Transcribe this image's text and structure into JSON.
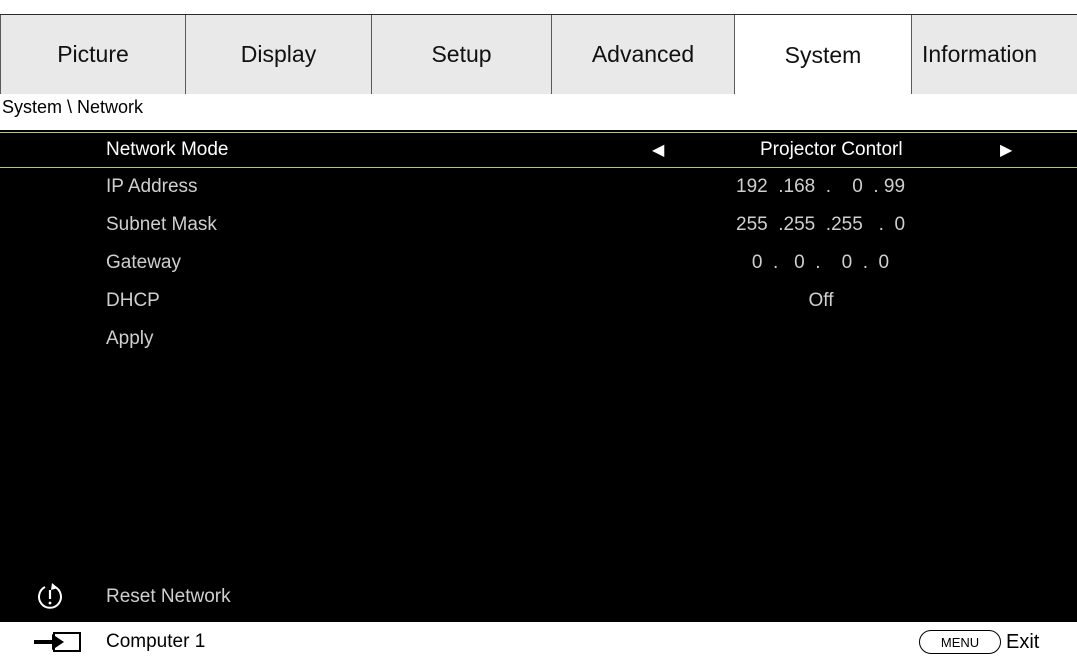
{
  "tabs": [
    {
      "label": "Picture",
      "active": false
    },
    {
      "label": "Display",
      "active": false
    },
    {
      "label": "Setup",
      "active": false
    },
    {
      "label": "Advanced",
      "active": false
    },
    {
      "label": "System",
      "active": true
    },
    {
      "label": "Information",
      "active": false
    }
  ],
  "breadcrumb": "System \\ Network",
  "menu": {
    "network_mode": {
      "label": "Network Mode",
      "value": "Projector Contorl"
    },
    "ip_address": {
      "label": "IP Address",
      "value": "192  .168  .    0  . 99"
    },
    "subnet_mask": {
      "label": "Subnet Mask",
      "value": "255  .255  .255   .  0"
    },
    "gateway": {
      "label": "Gateway",
      "value": "   0  .   0  .    0  .  0"
    },
    "dhcp": {
      "label": "DHCP",
      "value": "Off"
    },
    "apply": {
      "label": "Apply"
    },
    "reset": {
      "label": "Reset Network"
    }
  },
  "footer": {
    "source_label": "Computer 1",
    "menu_key": "MENU",
    "exit_label": "Exit"
  },
  "icons": {
    "left_arrow": "left-triangle",
    "right_arrow": "right-triangle",
    "reset": "power-reset-icon",
    "source": "input-source-icon"
  },
  "colors": {
    "background": "#000000",
    "selection_border": "#b3c97a",
    "tab_inactive": "#e9e9e9",
    "tab_active": "#ffffff"
  }
}
